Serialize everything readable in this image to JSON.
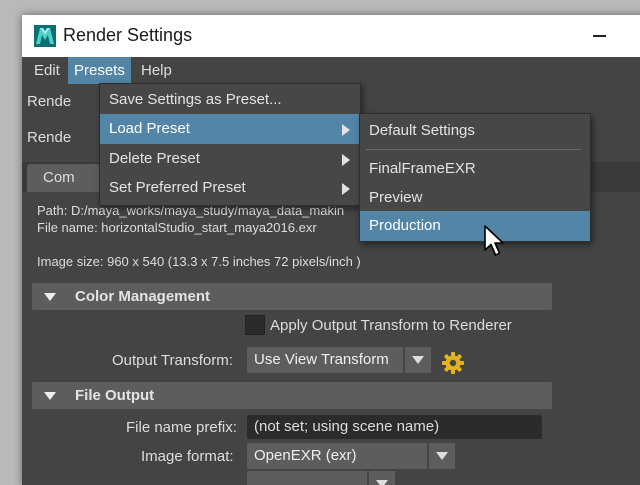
{
  "window": {
    "title": "Render Settings"
  },
  "menubar": {
    "items": [
      "Edit",
      "Presets",
      "Help"
    ],
    "active": "Presets"
  },
  "rows": {
    "render_layer_label": "Rende",
    "render_using_label": "Rende"
  },
  "tab": {
    "label": "Com"
  },
  "info": {
    "path": "Path: D:/maya_works/maya_study/maya_data_makin",
    "file_name": "File name:  horizontalStudio_start_maya2016.exr",
    "image_size": "Image size: 960 x 540 (13.3 x 7.5 inches 72 pixels/inch )"
  },
  "color_management": {
    "header": "Color Management",
    "apply_transform_label": "Apply Output Transform to Renderer",
    "apply_transform_checked": false,
    "output_transform_label": "Output Transform:",
    "output_transform_value": "Use View Transform"
  },
  "file_output": {
    "header": "File Output",
    "prefix_label": "File name prefix:",
    "prefix_value": "(not set; using scene name)",
    "format_label": "Image format:",
    "format_value": "OpenEXR (exr)"
  },
  "presets_menu": {
    "items": [
      {
        "label": "Save Settings as Preset...",
        "submenu": false
      },
      {
        "label": "Load Preset",
        "submenu": true,
        "highlighted": true
      },
      {
        "label": "Delete Preset",
        "submenu": true
      },
      {
        "label": "Set Preferred Preset",
        "submenu": true
      }
    ]
  },
  "load_preset_submenu": {
    "items": [
      "Default Settings",
      "FinalFrameEXR",
      "Preview",
      "Production"
    ],
    "highlighted": "Production"
  },
  "colors": {
    "highlight": "#5285a6",
    "panel": "#444444",
    "section": "#5d5d5d",
    "field": "#2b2b2b",
    "gear": "#e3b321"
  },
  "icons": {
    "app": "maya-icon",
    "gear": "gear-icon",
    "cursor": "mouse-pointer-icon"
  }
}
